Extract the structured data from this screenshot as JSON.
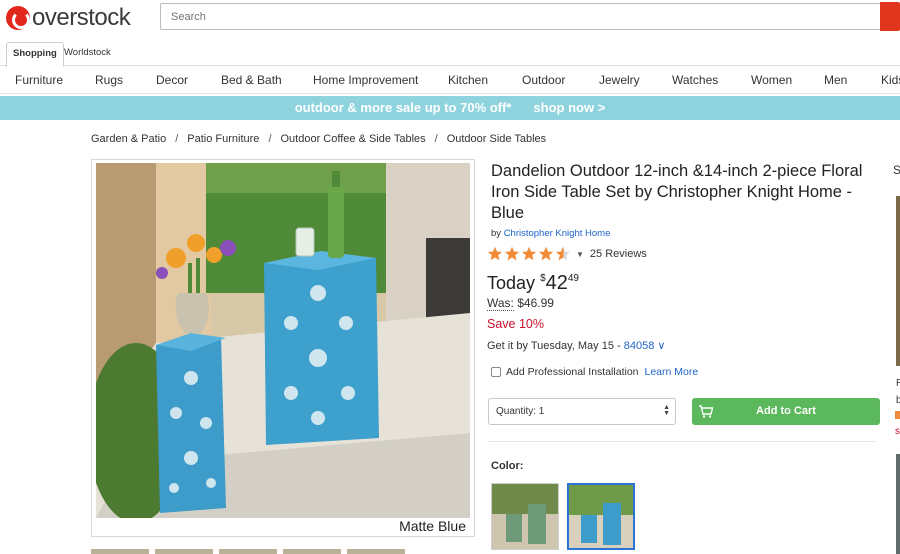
{
  "header": {
    "logo_text": "overstock",
    "search_placeholder": "Search"
  },
  "subtabs": [
    "Shopping",
    "Worldstock"
  ],
  "categories": [
    "Furniture",
    "Rugs",
    "Decor",
    "Bed & Bath",
    "Home Improvement",
    "Kitchen",
    "Outdoor",
    "Jewelry",
    "Watches",
    "Women",
    "Men",
    "Kids"
  ],
  "promo": {
    "text": "outdoor & more sale up to 70% off*",
    "cta": "shop now >"
  },
  "breadcrumb": [
    "Garden & Patio",
    "Patio Furniture",
    "Outdoor Coffee & Side Tables",
    "Outdoor Side Tables"
  ],
  "breadcrumb_sep": "/",
  "product": {
    "title": "Dandelion Outdoor 12-inch &14-inch 2-piece Floral Iron Side Table Set by Christopher Knight Home - Blue",
    "brand_prefix": "by",
    "brand": "Christopher Knight Home",
    "rating": 4.5,
    "reviews": "25 Reviews",
    "price_label": "Today",
    "price_currency": "$",
    "price_dollars": "42",
    "price_cents": "49",
    "was_label": "Was:",
    "was_price": "$46.99",
    "save": "Save 10%",
    "delivery_text": "Get it by Tuesday, May 15 -",
    "zip": "84058",
    "zip_caret": "∨",
    "install_label": "Add Professional Installation",
    "learn_more": "Learn More",
    "quantity_label": "Quantity: 1",
    "add_to_cart": "Add to Cart",
    "color_label": "Color:",
    "image_caption": "Matte Blue"
  },
  "colors": {
    "brand_red": "#e1261c",
    "promo_bg": "#8fd3de",
    "cart_green": "#5cb85c",
    "link_blue": "#1e64c8",
    "star_orange": "#f08b3a",
    "sale_red": "#c8102e"
  },
  "right_edge": {
    "t1": "R",
    "t2": "b",
    "t3": "s",
    "sym": "S"
  }
}
